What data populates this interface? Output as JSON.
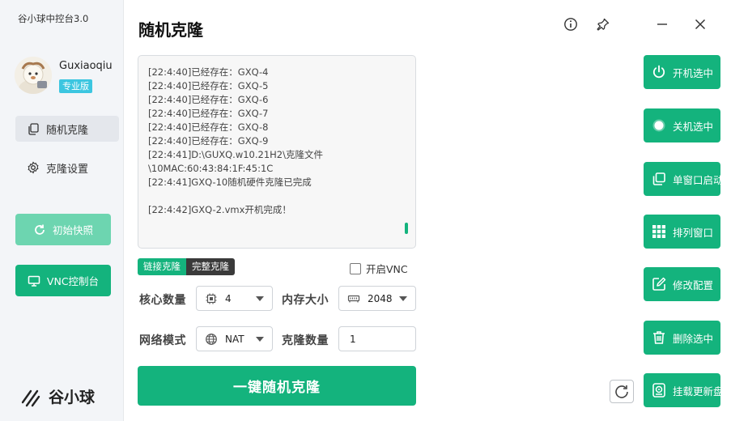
{
  "app": {
    "title": "谷小球中控台3.0",
    "page_title": "随机克隆"
  },
  "user": {
    "name": "Guxiaoqiu",
    "edition": "专业版"
  },
  "sidebar": {
    "items": [
      {
        "label": "随机克隆",
        "icon": "copy-icon",
        "active": true
      },
      {
        "label": "克隆设置",
        "icon": "gear-icon",
        "active": false
      }
    ],
    "snapshot_button": "初始快照",
    "vnc_button": "VNC控制台",
    "brand": "谷小球"
  },
  "log": {
    "lines": [
      "[22:4:40]已经存在：GXQ-4",
      "[22:4:40]已经存在：GXQ-5",
      "[22:4:40]已经存在：GXQ-6",
      "[22:4:40]已经存在：GXQ-7",
      "[22:4:40]已经存在：GXQ-8",
      "[22:4:40]已经存在：GXQ-9",
      "[22:4:41]D:\\GUXQ.w10.21H2\\克隆文件",
      "\\10MAC:60:43:84:1F:45:1C",
      "[22:4:41]GXQ-10随机硬件克隆已完成",
      "",
      "[22:4:42]GXQ-2.vmx开机完成！"
    ]
  },
  "clone_mode": {
    "options": [
      "链接克隆",
      "完整克隆"
    ],
    "selected": "链接克隆"
  },
  "vnc": {
    "label": "开启VNC",
    "checked": false
  },
  "form": {
    "cpu_label": "核心数量",
    "cpu_value": "4",
    "memory_label": "内存大小",
    "memory_value": "2048",
    "network_label": "网络模式",
    "network_value": "NAT",
    "clone_count_label": "克隆数量",
    "clone_count_value": "1"
  },
  "main_button": "一键随机克隆",
  "actions": [
    {
      "label": "开机选中",
      "icon": "power-icon"
    },
    {
      "label": "关机选中",
      "icon": "stop-circle-icon"
    },
    {
      "label": "单窗口启动",
      "icon": "windows-icon"
    },
    {
      "label": "排列窗口",
      "icon": "grid-icon"
    },
    {
      "label": "修改配置",
      "icon": "edit-icon"
    },
    {
      "label": "删除选中",
      "icon": "trash-icon"
    },
    {
      "label": "挂载更新盘",
      "icon": "disk-icon"
    }
  ],
  "colors": {
    "accent": "#14b37d",
    "accent_light": "#6dd5b0",
    "badge": "#3cc6e0"
  }
}
